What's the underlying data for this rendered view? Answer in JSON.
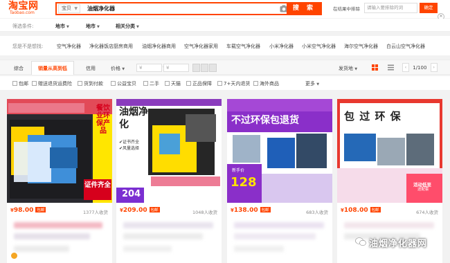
{
  "header": {
    "logo_cn": "淘宝网",
    "logo_en": "Taobao.com",
    "search_type": "宝贝",
    "search_query": "油烟净化器",
    "search_button": "搜 索",
    "sub_search_label": "在结果中排除",
    "sub_search_placeholder": "请输入要排除的词",
    "sub_search_button": "确定"
  },
  "filters": {
    "label": "筛选条件:",
    "options": [
      "地市",
      "地市",
      "相关分类"
    ]
  },
  "related": {
    "label": "您是不是想找:",
    "links": [
      "空气净化器",
      "净化器饭店厨房商用",
      "油烟净化器商用",
      "空气净化器家用",
      "车载空气净化器",
      "小米净化器",
      "小米空气净化器",
      "海尔空气净化器",
      "白云山空气净化器"
    ]
  },
  "sort": {
    "items": [
      "综合",
      "销量从高到低",
      "信用",
      "价格"
    ],
    "price_from": "¥",
    "price_to": "¥",
    "ship_from": "发货地",
    "page": "1/100"
  },
  "checks": [
    "包邮",
    "赠送退货运费险",
    "货到付款",
    "公益宝贝",
    "二手",
    "天猫",
    "正品保障",
    "7+天内退货",
    "海外商品",
    "更多"
  ],
  "products": [
    {
      "price": "98.00",
      "badge": "包邮",
      "sales": "1377人收货",
      "img_text": "餐饮业环保产品",
      "img_text2": "证件齐全"
    },
    {
      "price": "209.00",
      "badge": "包邮",
      "sales": "1048人收货",
      "img_text": "油烟净化",
      "img_text2": "活动价格",
      "img_price": "204",
      "bullets": [
        "证书齐全",
        "风量选择"
      ]
    },
    {
      "price": "138.00",
      "badge": "包邮",
      "sales": "683人收货",
      "img_text": "不过环保包退货",
      "img_text2": "新手价",
      "img_price": "128"
    },
    {
      "price": "108.00",
      "badge": "包邮",
      "sales": "674人收货",
      "img_text": "包 过 环 保",
      "img_text2": "活动低至",
      "img_text3": "送配套"
    }
  ],
  "currency": "¥",
  "watermark": "油烟净化器网",
  "colors": {
    "brand": "#ff4400",
    "banner_red": "#e8382f",
    "banner_purple": "#8b2fc9"
  }
}
